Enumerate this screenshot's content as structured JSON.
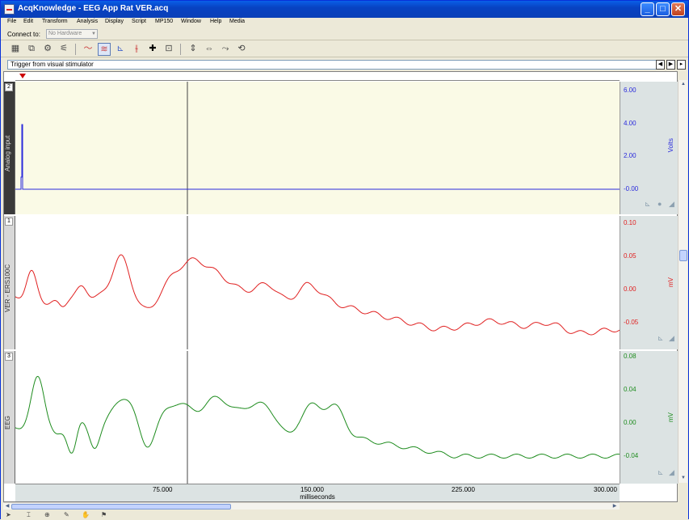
{
  "window": {
    "title": "AcqKnowledge - EEG App Rat VER.acq",
    "min": "_",
    "max": "□",
    "close": "✕"
  },
  "menu": [
    "File",
    "Edit",
    "Transform",
    "Analysis",
    "Display",
    "Script",
    "MP150",
    "Window",
    "Help",
    "Media"
  ],
  "connect": {
    "label": "Connect to:",
    "value": "No Hardware"
  },
  "trigger_text": "Trigger from visual stimulator",
  "nav_buttons": [
    "◀",
    "▶",
    "▸"
  ],
  "channels": [
    {
      "number": "2",
      "name": "Analog input",
      "unit": "Volts",
      "ticks": [
        "6.00",
        "4.00",
        "2.00",
        "-0.00"
      ],
      "color": "#2a2adc",
      "background": "#fafae6"
    },
    {
      "number": "1",
      "name": "VER - ERS100C",
      "unit": "mV",
      "ticks": [
        "0.10",
        "0.05",
        "0.00",
        "-0.05"
      ],
      "color": "#e02020",
      "background": "#ffffff"
    },
    {
      "number": "3",
      "name": "EEG",
      "unit": "mV",
      "ticks": [
        "0.08",
        "0.04",
        "0.00",
        "-0.04"
      ],
      "color": "#1e8c1e",
      "background": "#ffffff"
    }
  ],
  "xaxis": {
    "ticks": [
      "75.000",
      "150.000",
      "225.000",
      "300.000"
    ],
    "label": "milliseconds"
  },
  "cursor_ms": 88,
  "colors": {
    "titlebar": "#0a48d0",
    "scale_bg": "#dce3e3",
    "chrome": "#ece9d8"
  }
}
